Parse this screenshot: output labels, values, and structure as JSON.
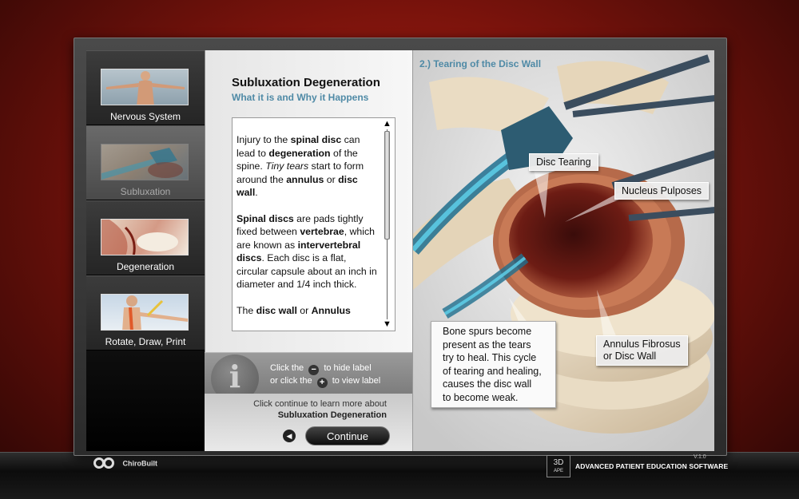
{
  "sidebar": {
    "items": [
      {
        "label": "Nervous System"
      },
      {
        "label": "Subluxation"
      },
      {
        "label": "Degeneration"
      },
      {
        "label": "Rotate, Draw, Print"
      }
    ]
  },
  "lesson": {
    "title": "Subluxation Degeneration",
    "subtitle": "What it is and Why it Happens",
    "paragraphs": [
      [
        {
          "t": "Injury to the ",
          "s": ""
        },
        {
          "t": "spinal disc",
          "s": "b"
        },
        {
          "t": " can lead to ",
          "s": ""
        },
        {
          "t": "degeneration",
          "s": "b"
        },
        {
          "t": " of the spine. ",
          "s": ""
        },
        {
          "t": "Tiny tears",
          "s": "i"
        },
        {
          "t": " start to form around the ",
          "s": ""
        },
        {
          "t": "annulus",
          "s": "b"
        },
        {
          "t": " or ",
          "s": ""
        },
        {
          "t": "disc wall",
          "s": "b"
        },
        {
          "t": ".",
          "s": ""
        }
      ],
      [
        {
          "t": "Spinal discs",
          "s": "b"
        },
        {
          "t": " are pads tightly fixed between ",
          "s": ""
        },
        {
          "t": "vertebrae",
          "s": "b"
        },
        {
          "t": ", which are known as ",
          "s": ""
        },
        {
          "t": "intervertebral discs",
          "s": "b"
        },
        {
          "t": ". Each disc is a flat, circular capsule about an inch in diameter and 1/4 inch thick.",
          "s": ""
        }
      ],
      [
        {
          "t": "The ",
          "s": ""
        },
        {
          "t": "disc wall",
          "s": "b"
        },
        {
          "t": " or ",
          "s": ""
        },
        {
          "t": "Annulus",
          "s": "b"
        }
      ]
    ],
    "scroll_up": "▲",
    "scroll_down": "▼"
  },
  "info": {
    "icon_letter": "i",
    "line1_pre": "Click the",
    "line1_post": "to hide label",
    "line2_pre": "or click the",
    "line2_post": "to view label",
    "minus_glyph": "−",
    "plus_glyph": "+"
  },
  "continue": {
    "hint": "Click continue to learn more about",
    "topic": "Subluxation Degeneration",
    "back_glyph": "◀",
    "button_label": "Continue"
  },
  "image": {
    "title": "2.) Tearing of the Disc Wall",
    "labels": {
      "disc_tearing": "Disc Tearing",
      "nucleus": "Nucleus Pulposes",
      "annulus_line1": "Annulus Fibrosus",
      "annulus_line2": "or Disc Wall"
    },
    "bone_spurs": [
      "Bone spurs become",
      "present as the tears",
      "try to heal. This cycle",
      "of tearing and healing,",
      "causes the disc wall",
      "to become weak."
    ]
  },
  "footer": {
    "logo_text": "ChiroBuilt",
    "brand_box_line1": "3D",
    "brand_box_line2": "APE",
    "brand_text": "ADVANCED PATIENT EDUCATION SOFTWARE",
    "version": "V.1.0"
  },
  "colors": {
    "accent": "#4f8aa6",
    "background_red": "#b02418"
  }
}
